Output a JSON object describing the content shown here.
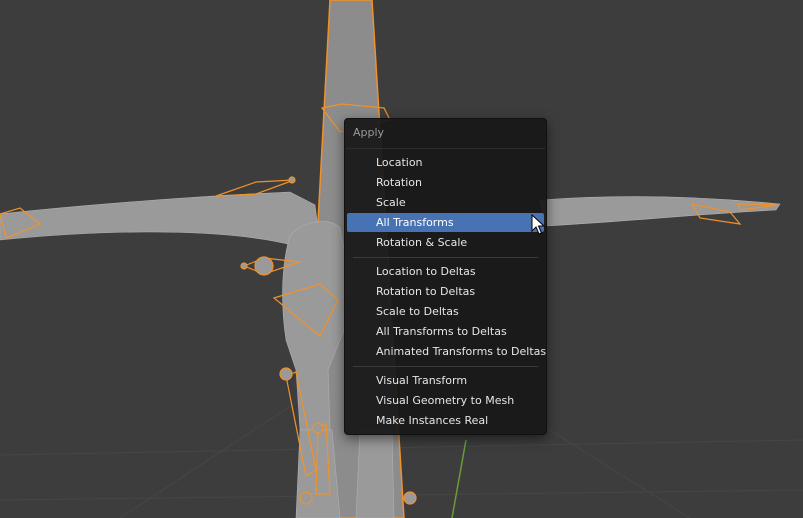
{
  "menu": {
    "title": "Apply",
    "groups": [
      {
        "items": [
          {
            "label": "Location"
          },
          {
            "label": "Rotation"
          },
          {
            "label": "Scale"
          },
          {
            "label": "All Transforms",
            "active": true
          },
          {
            "label": "Rotation & Scale"
          }
        ]
      },
      {
        "items": [
          {
            "label": "Location to Deltas"
          },
          {
            "label": "Rotation to Deltas"
          },
          {
            "label": "Scale to Deltas"
          },
          {
            "label": "All Transforms to Deltas"
          },
          {
            "label": "Animated Transforms to Deltas"
          }
        ]
      },
      {
        "items": [
          {
            "label": "Visual Transform"
          },
          {
            "label": "Visual Geometry to Mesh"
          },
          {
            "label": "Make Instances Real"
          }
        ]
      }
    ]
  },
  "colors": {
    "viewport_bg": "#3d3d3d",
    "menu_bg": "#181818",
    "highlight": "#4772b3",
    "selection_outline": "#f0922a",
    "mesh": "#9a9a9a"
  },
  "icons": [
    "mouse-pointer-icon"
  ]
}
